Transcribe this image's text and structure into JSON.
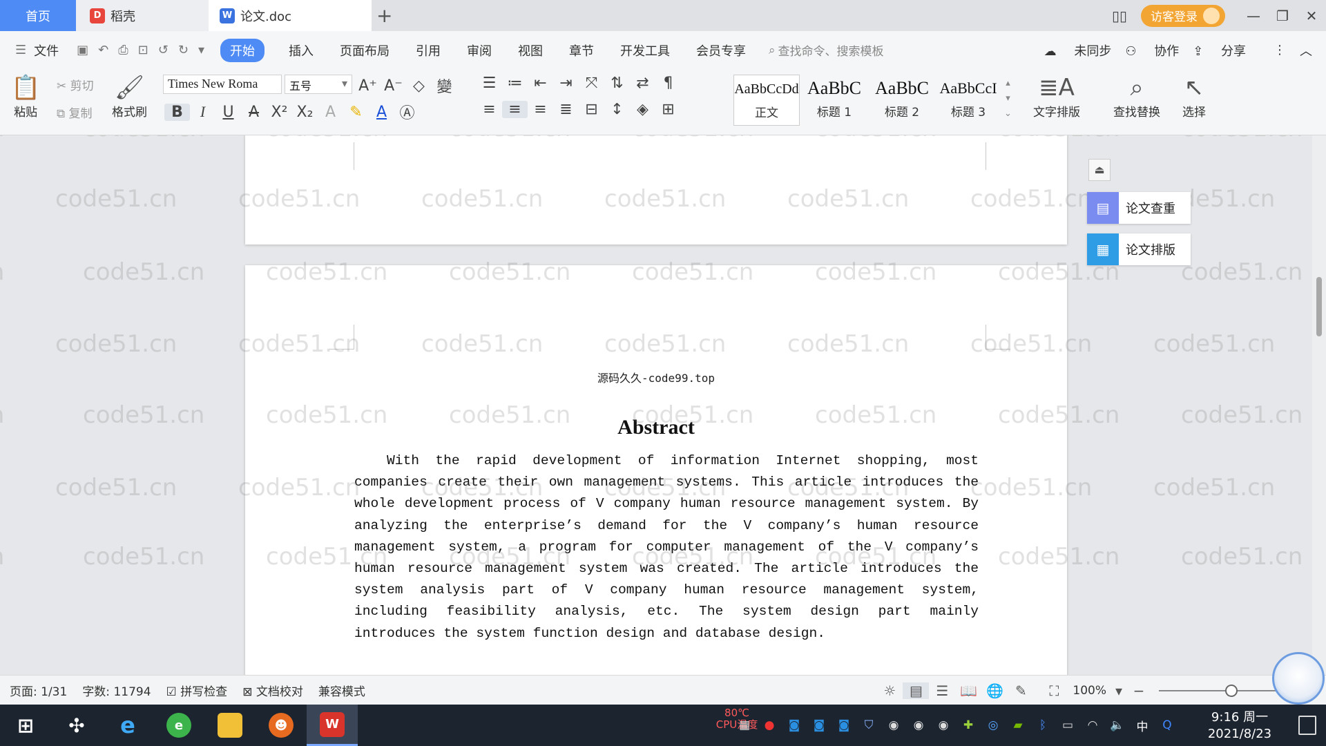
{
  "titlebar": {
    "tabs": [
      {
        "label": "首页"
      },
      {
        "label": "稻壳"
      },
      {
        "label": "论文.doc"
      }
    ],
    "new_tab": "+",
    "login": "访客登录"
  },
  "menubar": {
    "file": "文件",
    "start": "开始",
    "items": [
      "插入",
      "页面布局",
      "引用",
      "审阅",
      "视图",
      "章节",
      "开发工具",
      "会员专享"
    ],
    "search_placeholder": "查找命令、搜索模板",
    "sync": "未同步",
    "collab": "协作",
    "share": "分享"
  },
  "ribbon": {
    "paste": "粘贴",
    "cut": "剪切",
    "copy": "复制",
    "format_painter": "格式刷",
    "font_name": "Times New Roma",
    "font_size": "五号",
    "styles": [
      {
        "preview": "AaBbCcDd",
        "label": "正文"
      },
      {
        "preview": "AaBbC",
        "label": "标题 1"
      },
      {
        "preview": "AaBbC",
        "label": "标题 2"
      },
      {
        "preview": "AaBbCcI",
        "label": "标题 3"
      }
    ],
    "text_layout": "文字排版",
    "find_replace": "查找替换",
    "select": "选择"
  },
  "document": {
    "header_text": "源码久久-code99.top",
    "title": "Abstract",
    "body": "With the rapid development of information Internet shopping, most companies create their own management systems. This article introduces the whole development process of V company human resource management system. By analyzing the enterprise’s demand for the V company’s human resource management system, a program for computer management of the V company’s human resource management system was created. The article introduces the system analysis part of V company human resource management system, including feasibility analysis, etc. The system design part mainly introduces the system function design and database design.",
    "watermark": "code51.cn"
  },
  "side_panel": {
    "check": "论文查重",
    "layout": "论文排版"
  },
  "statusbar": {
    "page": "页面: 1/31",
    "words": "字数: 11794",
    "spell": "拼写检查",
    "proof": "文档校对",
    "compat": "兼容模式",
    "zoom": "100%"
  },
  "taskbar": {
    "cpu_temp": "80℃",
    "cpu_label": "CPU温度",
    "ime": "中",
    "time": "9:16 周一",
    "date": "2021/8/23"
  }
}
